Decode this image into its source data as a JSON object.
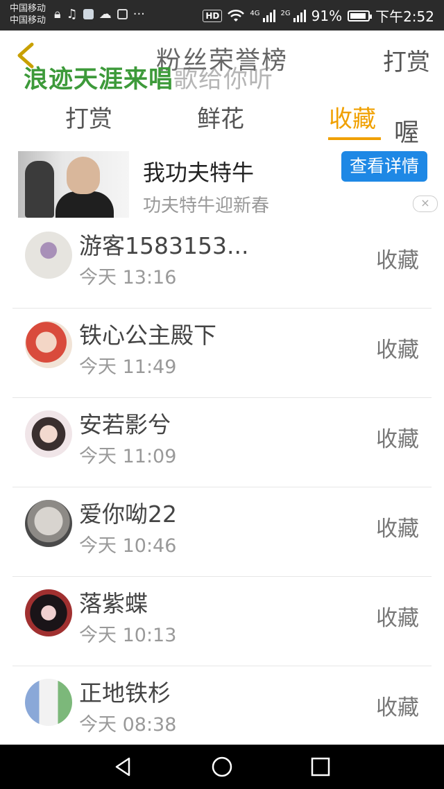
{
  "status_bar": {
    "carrier_1": "中国移动",
    "carrier_2": "中国移动",
    "network_1": "4G",
    "network_2": "2G",
    "battery": "91%",
    "battery_level": 0.91,
    "hd_label": "HD",
    "time": "下午2:52"
  },
  "header": {
    "title": "粉丝荣誉榜",
    "right_action": "打赏"
  },
  "overlay": {
    "caption_bold": "浪迹天涯来唱",
    "caption_faded": "歌给你听",
    "side_char": "喔"
  },
  "tabs": [
    {
      "label": "打赏",
      "active": false
    },
    {
      "label": "鲜花",
      "active": false
    },
    {
      "label": "收藏",
      "active": true
    }
  ],
  "ad": {
    "title": "我功夫特牛",
    "subtitle": "功夫特牛迎新春",
    "button": "查看详情",
    "close": "×"
  },
  "fans": [
    {
      "name": "游客1583153...",
      "time": "今天 13:16",
      "action": "收藏"
    },
    {
      "name": "铁心公主殿下",
      "time": "今天 11:49",
      "action": "收藏"
    },
    {
      "name": "安若影兮",
      "time": "今天 11:09",
      "action": "收藏"
    },
    {
      "name": "爱你呦22",
      "time": "今天 10:46",
      "action": "收藏"
    },
    {
      "name": "落紫蝶",
      "time": "今天 10:13",
      "action": "收藏"
    },
    {
      "name": "正地铁杉",
      "time": "今天 08:38",
      "action": "收藏"
    }
  ],
  "colors": {
    "accent": "#f0a000",
    "button_blue": "#1e88e5",
    "overlay_green": "#3d9a3a"
  }
}
